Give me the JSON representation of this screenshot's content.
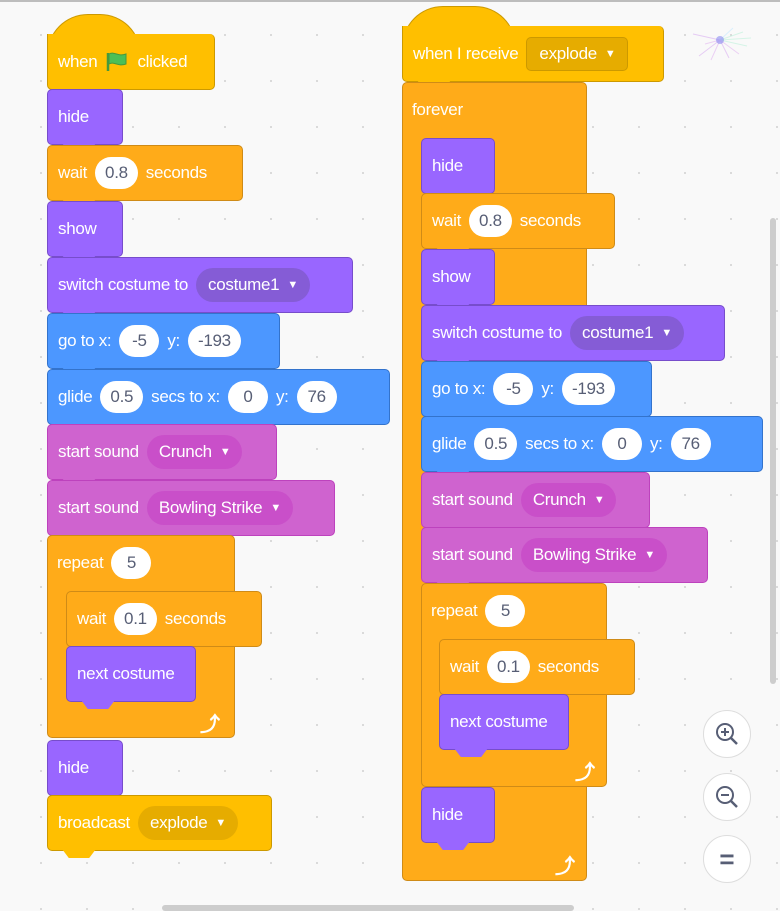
{
  "script1": {
    "hat": {
      "when": "when",
      "clicked": "clicked"
    },
    "hide1": "hide",
    "wait1": {
      "label": "wait",
      "value": "0.8",
      "unit": "seconds"
    },
    "show": "show",
    "switch": {
      "label": "switch costume to",
      "value": "costume1"
    },
    "goto": {
      "label_x": "go to x:",
      "x": "-5",
      "label_y": "y:",
      "y": "-193"
    },
    "glide": {
      "label": "glide",
      "secs": "0.5",
      "label_x": "secs to x:",
      "x": "0",
      "label_y": "y:",
      "y": "76"
    },
    "sound1": {
      "label": "start sound",
      "value": "Crunch"
    },
    "sound2": {
      "label": "start sound",
      "value": "Bowling Strike"
    },
    "repeat": {
      "label": "repeat",
      "value": "5"
    },
    "wait2": {
      "label": "wait",
      "value": "0.1",
      "unit": "seconds"
    },
    "next": "next costume",
    "hide2": "hide",
    "broadcast": {
      "label": "broadcast",
      "value": "explode"
    }
  },
  "script2": {
    "hat": {
      "label": "when I receive",
      "value": "explode"
    },
    "forever": "forever",
    "hide1": "hide",
    "wait1": {
      "label": "wait",
      "value": "0.8",
      "unit": "seconds"
    },
    "show": "show",
    "switch": {
      "label": "switch costume to",
      "value": "costume1"
    },
    "goto": {
      "label_x": "go to x:",
      "x": "-5",
      "label_y": "y:",
      "y": "-193"
    },
    "glide": {
      "label": "glide",
      "secs": "0.5",
      "label_x": "secs to x:",
      "x": "0",
      "label_y": "y:",
      "y": "76"
    },
    "sound1": {
      "label": "start sound",
      "value": "Crunch"
    },
    "sound2": {
      "label": "start sound",
      "value": "Bowling Strike"
    },
    "repeat": {
      "label": "repeat",
      "value": "5"
    },
    "wait2": {
      "label": "wait",
      "value": "0.1",
      "unit": "seconds"
    },
    "next": "next costume",
    "hide2": "hide"
  },
  "icons": {
    "caret": "▼",
    "loop": "⤴",
    "equals": "="
  },
  "colors": {
    "motion": "#4c97ff",
    "looks": "#9966ff",
    "sound": "#cf63cf",
    "control": "#ffab19",
    "events": "#ffbf00",
    "flag": "#4cbf56"
  }
}
